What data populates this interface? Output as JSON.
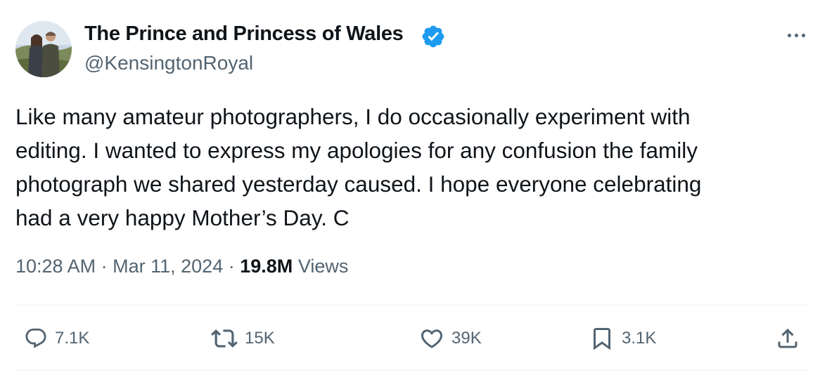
{
  "tweet": {
    "author": {
      "display_name": "The Prince and Princess of Wales",
      "handle": "@KensingtonRoyal",
      "verified": true,
      "avatar_icon": "avatar-photo"
    },
    "text_lines": [
      "Like many amateur photographers, I do occasionally experiment with",
      "editing. I wanted to express my apologies for any confusion the family",
      "photograph we shared yesterday caused. I hope everyone celebrating",
      "had a very happy Mother’s Day. C"
    ],
    "meta": {
      "time": "10:28 AM",
      "separator": "·",
      "date": "Mar 11, 2024",
      "views_count": "19.8M",
      "views_label": "Views"
    },
    "actions": {
      "reply": {
        "icon": "reply-icon",
        "count": "7.1K"
      },
      "retweet": {
        "icon": "retweet-icon",
        "count": "15K"
      },
      "like": {
        "icon": "heart-icon",
        "count": "39K"
      },
      "bookmark": {
        "icon": "bookmark-icon",
        "count": "3.1K"
      },
      "share": {
        "icon": "share-icon"
      }
    },
    "colors": {
      "verified_badge": "#1d9bf0",
      "secondary_text": "#536471",
      "primary_text": "#0f1419"
    }
  }
}
